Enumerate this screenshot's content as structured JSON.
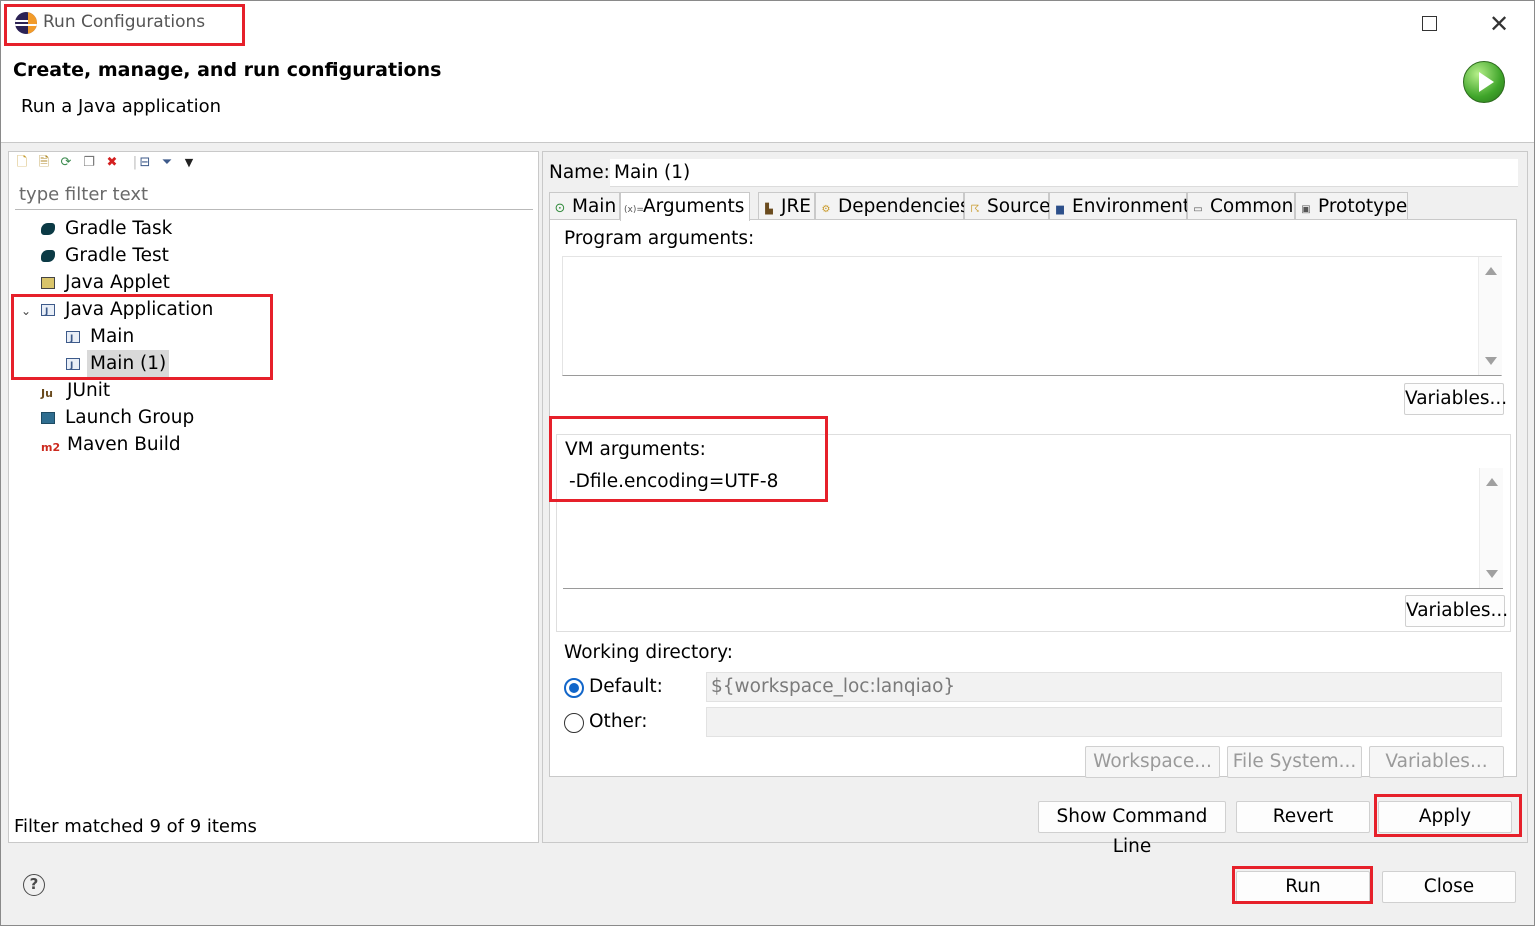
{
  "window": {
    "title": "Run Configurations",
    "header_title": "Create, manage, and run configurations",
    "header_subtitle": "Run a Java application"
  },
  "left_panel": {
    "filter_placeholder": "type filter text",
    "tree": [
      {
        "label": "Gradle Task",
        "icon": "gradle-icon"
      },
      {
        "label": "Gradle Test",
        "icon": "gradle-icon"
      },
      {
        "label": "Java Applet",
        "icon": "java-applet-icon"
      },
      {
        "label": "Java Application",
        "icon": "java-application-icon",
        "expanded": true
      },
      {
        "label": "Main",
        "icon": "java-application-icon"
      },
      {
        "label": "Main (1)",
        "icon": "java-application-icon",
        "selected": true
      },
      {
        "label": "JUnit",
        "icon": "junit-icon"
      },
      {
        "label": "Launch Group",
        "icon": "launch-group-icon"
      },
      {
        "label": "Maven Build",
        "icon": "maven-icon"
      }
    ],
    "status": "Filter matched 9 of 9 items"
  },
  "right_panel": {
    "name_label": "Name:",
    "name_value": "Main (1)",
    "tabs": [
      {
        "label": "Main",
        "active": false
      },
      {
        "label": "Arguments",
        "active": true
      },
      {
        "label": "JRE",
        "active": false
      },
      {
        "label": "Dependencies",
        "active": false
      },
      {
        "label": "Source",
        "active": false
      },
      {
        "label": "Environment",
        "active": false
      },
      {
        "label": "Common",
        "active": false
      },
      {
        "label": "Prototype",
        "active": false
      }
    ],
    "program_arguments": {
      "label": "Program arguments:",
      "value": "",
      "variables_button": "Variables..."
    },
    "vm_arguments": {
      "label": "VM arguments:",
      "value": "-Dfile.encoding=UTF-8",
      "variables_button": "Variables..."
    },
    "working_directory": {
      "label": "Working directory:",
      "default_label": "Default:",
      "default_value": "${workspace_loc:lanqiao}",
      "default_selected": true,
      "other_label": "Other:",
      "other_value": "",
      "workspace_button": "Workspace...",
      "filesystem_button": "File System...",
      "variables_button": "Variables..."
    },
    "show_command_line_button": "Show Command Line",
    "revert_button": "Revert",
    "apply_button": "Apply"
  },
  "footer": {
    "run_button": "Run",
    "close_button": "Close"
  },
  "colors": {
    "highlight": "#e6202a",
    "radio_accent": "#1266c9"
  }
}
